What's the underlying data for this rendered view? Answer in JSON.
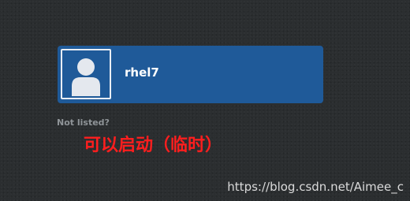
{
  "user_list": {
    "items": [
      {
        "username": "rhel7",
        "avatar_icon": "user-avatar-icon",
        "selected": true
      }
    ],
    "not_listed_label": "Not listed?"
  },
  "annotation": {
    "text": "可以启动（临时）",
    "color": "#ff1e1e"
  },
  "watermark": {
    "text": "https://blog.csdn.net/Aimee_c"
  },
  "colors": {
    "background": "#2b2e30",
    "selected_row": "#1f5a99",
    "muted_text": "#8f9498"
  }
}
